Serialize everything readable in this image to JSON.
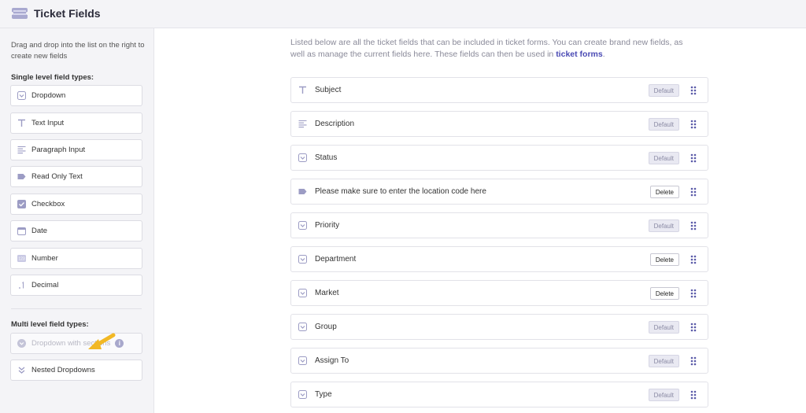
{
  "header": {
    "title": "Ticket Fields",
    "icon": "ticket-icon"
  },
  "sidebar": {
    "hint": "Drag and drop into the list on the right to create new fields",
    "single_title": "Single level field types:",
    "single_types": [
      {
        "label": "Dropdown",
        "icon": "dropdown-icon"
      },
      {
        "label": "Text Input",
        "icon": "text-input-icon"
      },
      {
        "label": "Paragraph Input",
        "icon": "paragraph-icon"
      },
      {
        "label": "Read Only Text",
        "icon": "label-tag-icon"
      },
      {
        "label": "Checkbox",
        "icon": "checkbox-icon"
      },
      {
        "label": "Date",
        "icon": "calendar-icon"
      },
      {
        "label": "Number",
        "icon": "number-icon"
      },
      {
        "label": "Decimal",
        "icon": "decimal-icon"
      }
    ],
    "multi_title": "Multi level field types:",
    "multi_types": [
      {
        "label": "Dropdown with sections",
        "icon": "sections-icon",
        "disabled": true,
        "badge": "i"
      },
      {
        "label": "Nested Dropdowns",
        "icon": "nested-icon",
        "disabled": false
      }
    ]
  },
  "main": {
    "description": "Listed below are all the ticket fields that can be included in ticket forms. You can create brand new fields, as well as manage the current fields here. These fields can then be used in",
    "description_link": "ticket forms",
    "description_end": ".",
    "fields": [
      {
        "label": "Subject",
        "icon": "text-input-icon",
        "action": "Default"
      },
      {
        "label": "Description",
        "icon": "paragraph-icon",
        "action": "Default"
      },
      {
        "label": "Status",
        "icon": "dropdown-icon",
        "action": "Default"
      },
      {
        "label": "Please make sure to enter the location code here",
        "icon": "label-tag-icon",
        "action": "Delete"
      },
      {
        "label": "Priority",
        "icon": "dropdown-icon",
        "action": "Default"
      },
      {
        "label": "Department",
        "icon": "dropdown-icon",
        "action": "Delete"
      },
      {
        "label": "Market",
        "icon": "dropdown-icon",
        "action": "Delete"
      },
      {
        "label": "Group",
        "icon": "dropdown-icon",
        "action": "Default"
      },
      {
        "label": "Assign To",
        "icon": "dropdown-icon",
        "action": "Default"
      },
      {
        "label": "Type",
        "icon": "dropdown-icon",
        "action": "Default"
      }
    ]
  },
  "colors": {
    "accent": "#4a4ab4",
    "icon": "#9c9cc4",
    "arrow": "#f2b824"
  }
}
